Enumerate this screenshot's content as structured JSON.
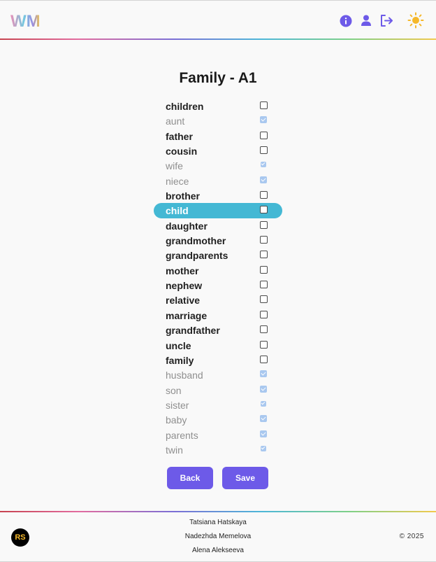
{
  "header": {
    "logo_text": "WM",
    "icons": [
      "info-icon",
      "user-icon",
      "logout-icon",
      "sun-icon"
    ],
    "accent_color": "#6d5ae8",
    "sun_color": "#f5b82a"
  },
  "main": {
    "title": "Family - A1",
    "words": [
      {
        "label": "children",
        "learned": false,
        "active": false
      },
      {
        "label": "aunt",
        "learned": true,
        "active": false
      },
      {
        "label": "father",
        "learned": false,
        "active": false
      },
      {
        "label": "cousin",
        "learned": false,
        "active": false
      },
      {
        "label": "wife",
        "learned": true,
        "active": false
      },
      {
        "label": "niece",
        "learned": true,
        "active": false
      },
      {
        "label": "brother",
        "learned": false,
        "active": false
      },
      {
        "label": "child",
        "learned": false,
        "active": true
      },
      {
        "label": "daughter",
        "learned": false,
        "active": false
      },
      {
        "label": "grandmother",
        "learned": false,
        "active": false
      },
      {
        "label": "grandparents",
        "learned": false,
        "active": false
      },
      {
        "label": "mother",
        "learned": false,
        "active": false
      },
      {
        "label": "nephew",
        "learned": false,
        "active": false
      },
      {
        "label": "relative",
        "learned": false,
        "active": false
      },
      {
        "label": "marriage",
        "learned": false,
        "active": false
      },
      {
        "label": "grandfather",
        "learned": false,
        "active": false
      },
      {
        "label": "uncle",
        "learned": false,
        "active": false
      },
      {
        "label": "family",
        "learned": false,
        "active": false
      },
      {
        "label": "husband",
        "learned": true,
        "active": false
      },
      {
        "label": "son",
        "learned": true,
        "active": false
      },
      {
        "label": "sister",
        "learned": true,
        "active": false
      },
      {
        "label": "baby",
        "learned": true,
        "active": false
      },
      {
        "label": "parents",
        "learned": true,
        "active": false
      },
      {
        "label": "twin",
        "learned": true,
        "active": false
      }
    ],
    "back_label": "Back",
    "save_label": "Save",
    "active_row_color": "#44b8d4"
  },
  "footer": {
    "badge": "RS",
    "authors": [
      "Tatsiana Hatskaya",
      "Nadezhda Memelova",
      "Alena Alekseeva"
    ],
    "copyright": "© 2025"
  }
}
